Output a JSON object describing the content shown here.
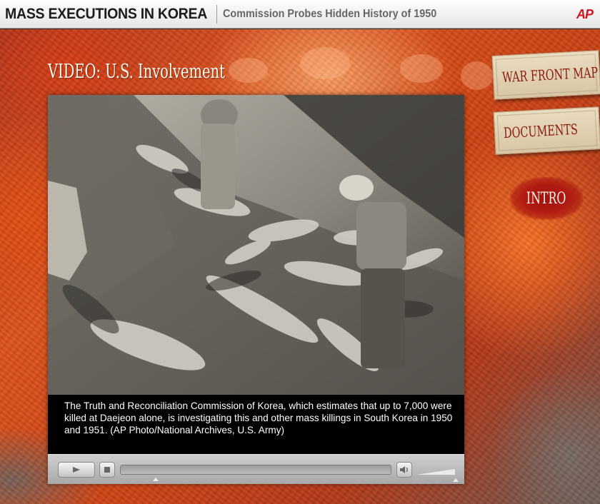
{
  "header": {
    "title": "MASS EXECUTIONS IN KOREA",
    "subtitle": "Commission Probes Hidden History of 1950",
    "logo": "AP"
  },
  "main": {
    "video_heading": "VIDEO: U.S. Involvement",
    "caption": "The Truth and Reconciliation Commission of Korea, which estimates that up to 7,000 were killed at Daejeon alone, is investigating this and other mass killings in South Korea in 1950 and 1951. (AP Photo/National Archives, U.S. Army)"
  },
  "nav": {
    "war_front_map": "WAR FRONT MAP",
    "documents": "DOCUMENTS",
    "intro": "INTRO"
  },
  "player": {
    "play_icon": "play-icon",
    "stop_icon": "stop-icon",
    "volume_icon": "speaker-icon",
    "progress": 0.13,
    "volume": 1.0
  },
  "colors": {
    "accent_red": "#d0161d",
    "tag_text": "#8a1a0f",
    "background_orange": "#e0541e"
  }
}
